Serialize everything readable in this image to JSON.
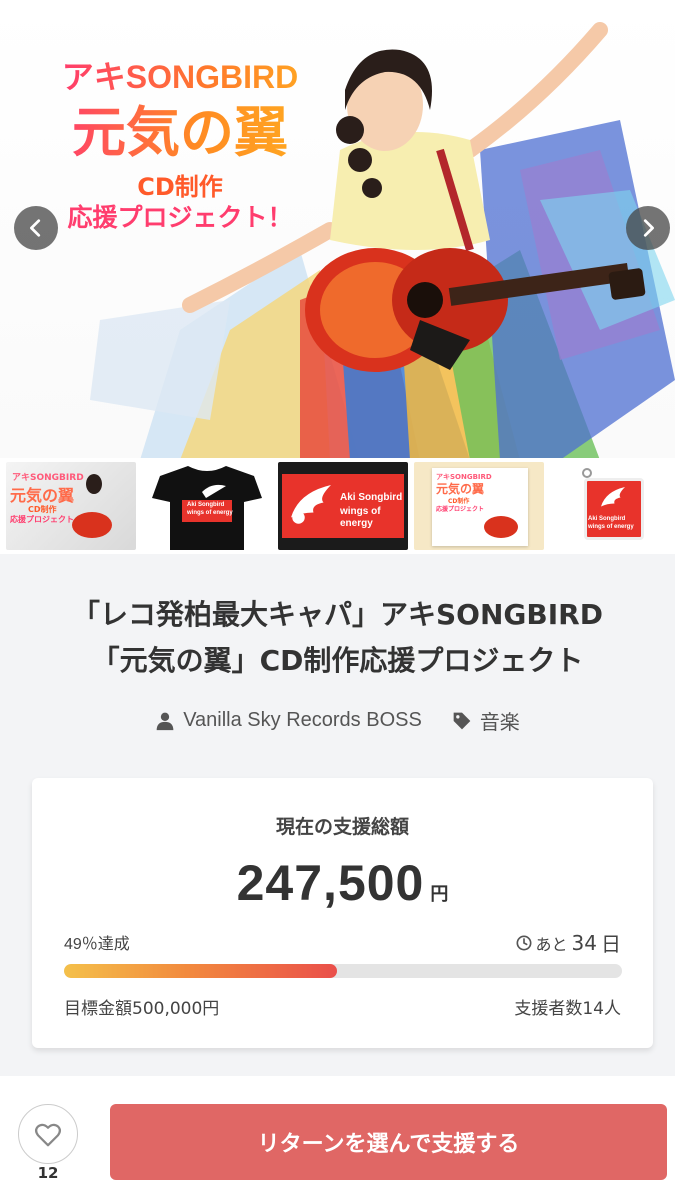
{
  "hero": {
    "title_line1": "アキSONGBIRD",
    "title_line2": "元気の翼",
    "title_line3": "CD制作",
    "title_line4": "応援プロジェクト！",
    "prev_icon": "chevron-left-icon",
    "next_icon": "chevron-right-icon"
  },
  "thumbnails": [
    {
      "name": "thumb-cover",
      "text1": "アキSONGBIRD",
      "text2": "元気の翼",
      "text3": "CD制作",
      "text4": "応援プロジェクト"
    },
    {
      "name": "thumb-tshirt",
      "text1": "Aki Songbird",
      "text2": "wings of energy"
    },
    {
      "name": "thumb-banner",
      "text1": "Aki Songbird",
      "text2": "wings of energy"
    },
    {
      "name": "thumb-cd",
      "text1": "アキSONGBIRD",
      "text2": "元気の翼",
      "text3": "CD制作",
      "text4": "応援プロジェクト"
    },
    {
      "name": "thumb-keychain",
      "text1": "Aki Songbird",
      "text2": "wings of energy"
    }
  ],
  "project": {
    "title_line1": "「レコ発柏最大キャパ」アキSONGBIRD",
    "title_line2": "「元気の翼」CD制作応援プロジェクト",
    "owner": "Vanilla Sky Records BOSS",
    "category": "音楽"
  },
  "funding": {
    "label": "現在の支援総額",
    "amount": "247,500",
    "currency": "円",
    "rate": "49％達成",
    "progress_percent": 49,
    "remaining_prefix": "あと",
    "remaining_days": "34",
    "remaining_unit": "日",
    "goal": "目標金額500,000円",
    "backers": "支援者数14人"
  },
  "actions": {
    "like_count": "12",
    "cta_label": "リターンを選んで支援する"
  },
  "colors": {
    "accent": "#e06765",
    "progress_start": "#f4c04a",
    "progress_end": "#ea4f4a"
  }
}
